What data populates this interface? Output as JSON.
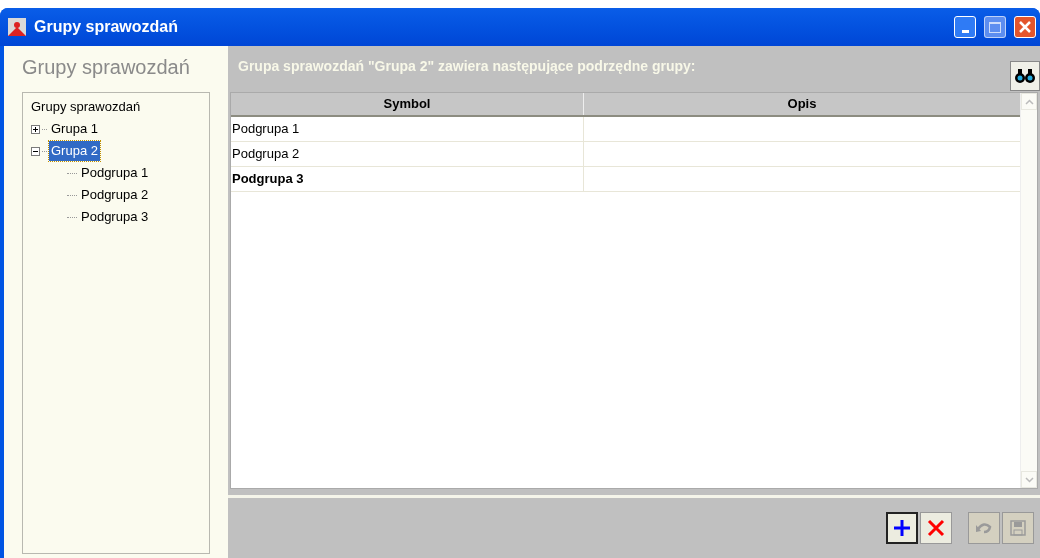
{
  "window": {
    "title": "Grupy sprawozdań"
  },
  "sidebar": {
    "heading": "Grupy sprawozdań",
    "tree": {
      "label": "Grupy sprawozdań",
      "children": [
        {
          "label": "Grupa 1",
          "expanded": false,
          "selected": false
        },
        {
          "label": "Grupa 2",
          "expanded": true,
          "selected": true,
          "children": [
            {
              "label": "Podgrupa 1",
              "selected": false
            },
            {
              "label": "Podgrupa 2",
              "selected": false
            },
            {
              "label": "Podgrupa 3",
              "selected": false
            }
          ]
        }
      ]
    }
  },
  "main": {
    "caption": "Grupa sprawozdań \"Grupa 2\" zawiera następujące podrzędne grupy:",
    "table": {
      "columns": [
        "Symbol",
        "Opis"
      ],
      "rows": [
        {
          "symbol": "Podgrupa 1",
          "bold": false
        },
        {
          "symbol": "Podgrupa 2",
          "bold": false
        },
        {
          "symbol": "Podgrupa 3",
          "bold": true
        }
      ]
    },
    "buttons": [
      {
        "kind": "add",
        "disabled": false
      },
      {
        "kind": "delete",
        "disabled": false
      },
      {
        "kind": "undo",
        "disabled": true
      },
      {
        "kind": "save",
        "disabled": true
      }
    ]
  }
}
